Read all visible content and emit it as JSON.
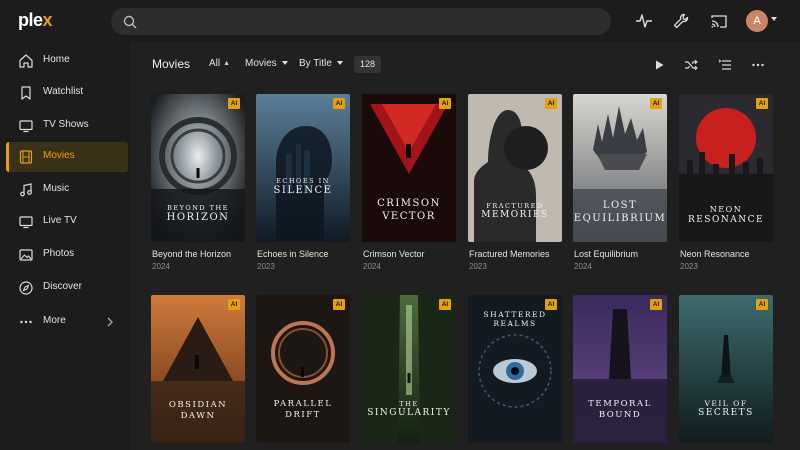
{
  "app": {
    "logo_main": "ple",
    "logo_accent": "x"
  },
  "search": {
    "placeholder": ""
  },
  "topbar": {
    "avatar_initial": "A",
    "icons": [
      "activity-icon",
      "settings-wrench-icon",
      "cast-icon"
    ]
  },
  "sidebar": {
    "items": [
      {
        "label": "Home",
        "icon": "home-icon"
      },
      {
        "label": "Watchlist",
        "icon": "bookmark-icon"
      },
      {
        "label": "TV Shows",
        "icon": "tv-icon"
      },
      {
        "label": "Movies",
        "icon": "film-icon",
        "active": true
      },
      {
        "label": "Music",
        "icon": "music-icon"
      },
      {
        "label": "Live TV",
        "icon": "live-tv-icon"
      },
      {
        "label": "Photos",
        "icon": "photos-icon"
      },
      {
        "label": "Discover",
        "icon": "compass-icon"
      },
      {
        "label": "More",
        "icon": "more-dots-icon"
      }
    ]
  },
  "library": {
    "title": "Movies",
    "filters": {
      "all": "All",
      "type": "Movies",
      "sort": "By Title"
    },
    "count": "128",
    "toolbar_icons": [
      "play-icon",
      "shuffle-icon",
      "list-view-icon",
      "more-options-icon"
    ]
  },
  "movies": [
    {
      "title": "Beyond the Horizon",
      "year": "2024",
      "poster_l1": "BEYOND THE",
      "poster_l2": "HORIZON",
      "badge": "AI"
    },
    {
      "title": "Echoes in Silence",
      "year": "2023",
      "poster_l1": "ECHOES IN",
      "poster_l2": "SILENCE",
      "badge": "AI"
    },
    {
      "title": "Crimson Vector",
      "year": "2024",
      "poster_l1": "CRIMSON",
      "poster_l2": "VECTOR",
      "badge": "AI"
    },
    {
      "title": "Fractured Memories",
      "year": "2023",
      "poster_l1": "FRACTURED",
      "poster_l2": "MEMORIES",
      "badge": "AI"
    },
    {
      "title": "Lost Equilibrium",
      "year": "2024",
      "poster_l1": "LOST",
      "poster_l2": "EQUILIBRIUM",
      "badge": "AI"
    },
    {
      "title": "Neon Resonance",
      "year": "2023",
      "poster_l1": "NEON",
      "poster_l2": "RESONANCE",
      "badge": "AI"
    },
    {
      "poster_l1": "OBSIDIAN",
      "poster_l2": "DAWN",
      "badge": "AI"
    },
    {
      "poster_l1": "PARALLEL",
      "poster_l2": "DRIFT",
      "badge": "AI"
    },
    {
      "poster_l1": "THE",
      "poster_l2": "SINGULARITY",
      "badge": "AI"
    },
    {
      "poster_l1": "SHATTERED",
      "poster_l2": "REALMS",
      "badge": "AI"
    },
    {
      "poster_l1": "TEMPORAL",
      "poster_l2": "BOUND",
      "badge": "AI"
    },
    {
      "poster_l1": "VEIL OF",
      "poster_l2": "SECRETS",
      "badge": "AI"
    }
  ],
  "colors": {
    "accent": "#e5a00d",
    "background": "#1c1c1c",
    "surface": "#202020"
  }
}
